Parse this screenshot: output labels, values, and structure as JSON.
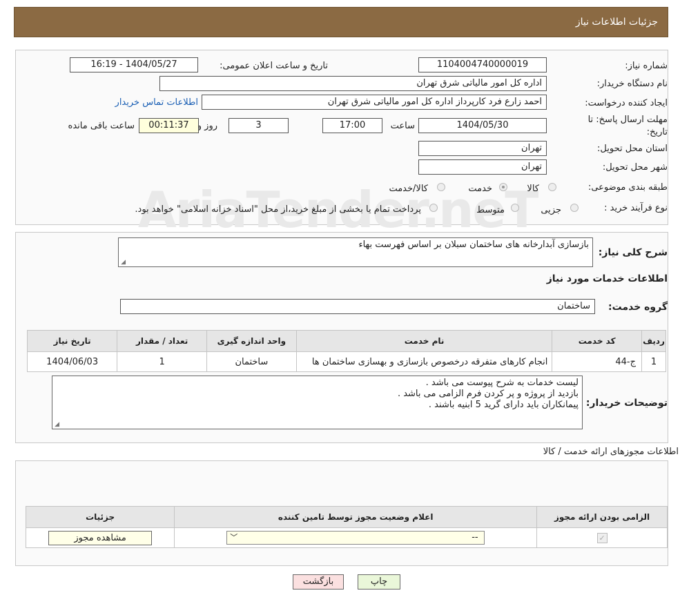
{
  "header": {
    "title": "جزئیات اطلاعات نیاز"
  },
  "watermark": {
    "text": "AriaTender.neT"
  },
  "form": {
    "need_number": {
      "label": "شماره نیاز:",
      "value": "1104004740000019"
    },
    "announce_datetime": {
      "label": "تاریخ و ساعت اعلان عمومی:",
      "value": "1404/05/27 - 16:19"
    },
    "buyer_org": {
      "label": "نام دستگاه خریدار:",
      "value": "اداره کل امور مالیاتی شرق تهران"
    },
    "requester": {
      "label": "ایجاد کننده درخواست:",
      "value": "احمد  زارع فرد کارپرداز اداره کل امور مالیاتی شرق تهران",
      "contact_link": "اطلاعات تماس خریدار"
    },
    "deadline": {
      "label": "مهلت ارسال پاسخ: تا تاریخ:",
      "date": "1404/05/30",
      "time_label": "ساعت",
      "time": "17:00",
      "days": "3",
      "days_label": "روز و",
      "remaining": "00:11:37",
      "remaining_label": "ساعت باقی مانده"
    },
    "province": {
      "label": "استان محل تحویل:",
      "value": "تهران"
    },
    "city": {
      "label": "شهر محل تحویل:",
      "value": "تهران"
    },
    "category": {
      "label": "طبقه بندی موضوعی:",
      "options": [
        "کالا",
        "خدمت",
        "کالا/خدمت"
      ],
      "selected": "خدمت"
    },
    "purchase_type": {
      "label": "نوع فرآیند خرید :",
      "options": [
        "جزیی",
        "متوسط"
      ],
      "selected": "متوسط",
      "note": "پرداخت تمام یا بخشی از مبلغ خرید،از محل \"اسناد خزانه اسلامی\" خواهد بود."
    }
  },
  "summary": {
    "label": "شرح کلی نیاز:",
    "value": "بازسازی آبدارخانه های ساختمان سبلان بر اساس فهرست بهاء"
  },
  "services": {
    "title": "اطلاعات خدمات مورد نیاز",
    "group_label": "گروه خدمت:",
    "group_value": "ساختمان",
    "columns": [
      "ردیف",
      "کد خدمت",
      "نام خدمت",
      "واحد اندازه گیری",
      "تعداد / مقدار",
      "تاریخ نیاز"
    ],
    "rows": [
      {
        "row": "1",
        "code": "ج-44",
        "name": "انجام کارهای متفرقه درخصوص بازسازی و بهسازی ساختمان ها",
        "unit": "ساختمان",
        "qty": "1",
        "date": "1404/06/03"
      }
    ]
  },
  "buyer_notes": {
    "label": "توضیحات خریدار:",
    "lines": [
      "لیست خدمات به شرح پیوست می باشد .",
      "بازدید از پروژه و پر کردن فرم الزامی می باشد .",
      "پیمانکاران باید دارای گرید 5 ابنیه باشند ."
    ]
  },
  "licenses": {
    "title": "اطلاعات مجوزهای ارائه خدمت / کالا",
    "columns": [
      "الزامی بودن ارائه مجوز",
      "اعلام وضعیت مجوز توسط تامین کننده",
      "جزئیات"
    ],
    "row": {
      "status_select": "--",
      "view_button": "مشاهده مجوز",
      "required_checked": true
    }
  },
  "actions": {
    "print": "چاپ",
    "back": "بازگشت"
  }
}
